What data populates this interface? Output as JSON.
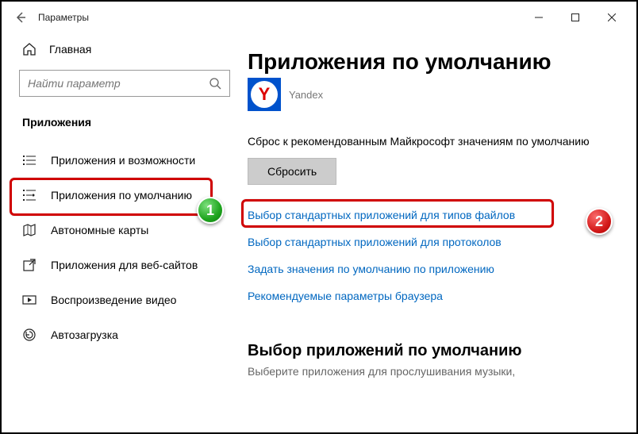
{
  "window": {
    "title": "Параметры"
  },
  "sidebar": {
    "home": "Главная",
    "search_placeholder": "Найти параметр",
    "section": "Приложения",
    "items": [
      {
        "label": "Приложения и возможности"
      },
      {
        "label": "Приложения по умолчанию"
      },
      {
        "label": "Автономные карты"
      },
      {
        "label": "Приложения для веб-сайтов"
      },
      {
        "label": "Воспроизведение видео"
      },
      {
        "label": "Автозагрузка"
      }
    ]
  },
  "content": {
    "title": "Приложения по умолчанию",
    "app_name": "Yandex",
    "reset_desc": "Сброс к рекомендованным Майкрософт значениям по умолчанию",
    "reset_btn": "Сбросить",
    "links": [
      "Выбор стандартных приложений для типов файлов",
      "Выбор стандартных приложений для протоколов",
      "Задать значения по умолчанию по приложению",
      "Рекомендуемые параметры браузера"
    ],
    "sub_heading": "Выбор приложений по умолчанию",
    "sub_desc": "Выберите приложения для прослушивания музыки,"
  },
  "annotations": {
    "badge1": "1",
    "badge2": "2"
  }
}
